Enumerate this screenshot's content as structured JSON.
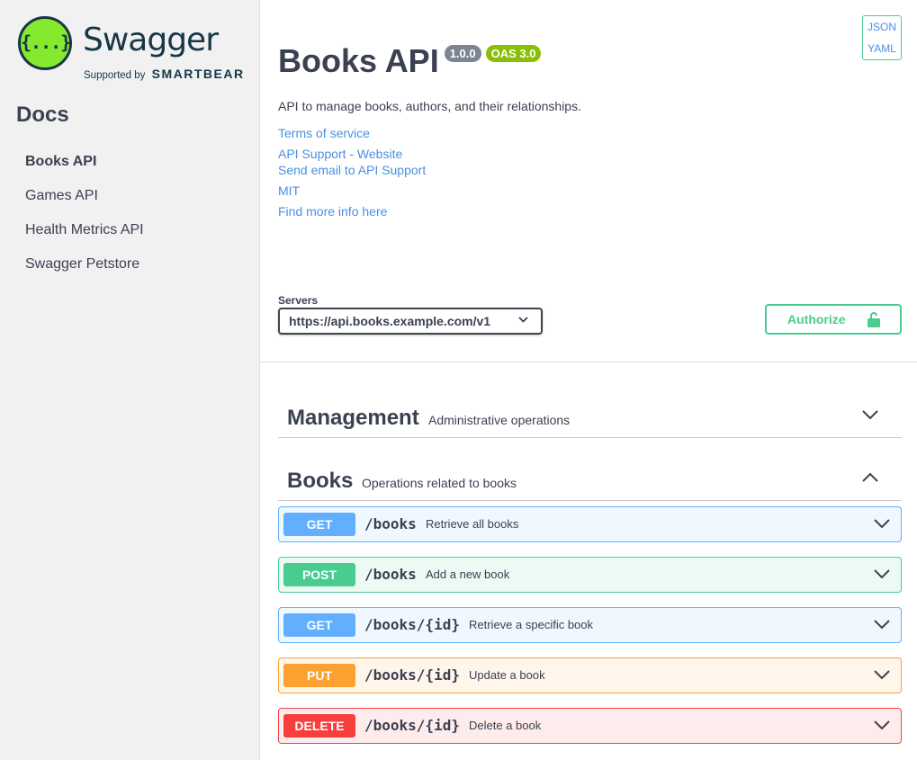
{
  "sidebar": {
    "logo": {
      "word": "Swagger",
      "glyph": "{...}",
      "supported_by": "Supported by",
      "brand": "SMARTBEAR"
    },
    "docs_title": "Docs",
    "items": [
      {
        "label": "Books API",
        "active": true
      },
      {
        "label": "Games API",
        "active": false
      },
      {
        "label": "Health Metrics API",
        "active": false
      },
      {
        "label": "Swagger Petstore",
        "active": false
      }
    ]
  },
  "info": {
    "title": "Books API",
    "version": "1.0.0",
    "oas": "OAS 3.0",
    "description": "API to manage books, authors, and their relationships.",
    "links": {
      "terms": "Terms of service",
      "support_site": "API Support - Website",
      "support_email": "Send email to API Support",
      "license": "MIT",
      "more_info": "Find more info here"
    }
  },
  "format_links": {
    "json": "JSON",
    "yaml": "YAML"
  },
  "servers": {
    "label": "Servers",
    "selected": "https://api.books.example.com/v1"
  },
  "authorize": {
    "label": "Authorize"
  },
  "tags": [
    {
      "name": "Management",
      "description": "Administrative operations",
      "expanded": false
    },
    {
      "name": "Books",
      "description": "Operations related to books",
      "expanded": true
    }
  ],
  "operations": [
    {
      "method": "GET",
      "path": "/books",
      "summary": "Retrieve all books"
    },
    {
      "method": "POST",
      "path": "/books",
      "summary": "Add a new book"
    },
    {
      "method": "GET",
      "path": "/books/{id}",
      "summary": "Retrieve a specific book"
    },
    {
      "method": "PUT",
      "path": "/books/{id}",
      "summary": "Update a book"
    },
    {
      "method": "DELETE",
      "path": "/books/{id}",
      "summary": "Delete a book"
    }
  ],
  "colors": {
    "get": "#61affe",
    "post": "#49cc90",
    "put": "#fca130",
    "delete": "#f93e3e",
    "link": "#4990e2",
    "text": "#3b4151",
    "oas_badge": "#89bf04",
    "version_badge": "#7d8492"
  },
  "icons": {
    "tag_collapsed": "chevron-down-icon",
    "tag_expanded": "chevron-up-icon",
    "lock": "lock-icon",
    "select": "chevron-down-icon"
  }
}
